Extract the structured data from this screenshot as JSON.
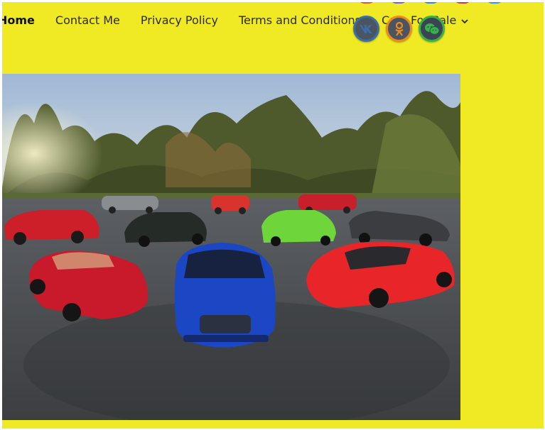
{
  "nav": {
    "items": [
      {
        "label": "Home",
        "active": true
      },
      {
        "label": "Contact Me",
        "active": false
      },
      {
        "label": "Privacy Policy",
        "active": false
      },
      {
        "label": "Terms and Conditions",
        "active": false
      },
      {
        "label": "Cars For Sale",
        "active": false,
        "has_dropdown": true
      }
    ],
    "dropdown_icon": "chevron-down-icon"
  },
  "social": {
    "icons": [
      {
        "name": "vk-icon",
        "color": "#3a6ea8"
      },
      {
        "name": "odnoklassniki-icon",
        "color": "#f08a1c"
      },
      {
        "name": "wechat-icon",
        "color": "#36b24a"
      }
    ]
  },
  "colors": {
    "background": "#f0ea24",
    "nav_text": "#2e2a10"
  },
  "hero": {
    "image": "group-of-sports-cars-photo"
  }
}
